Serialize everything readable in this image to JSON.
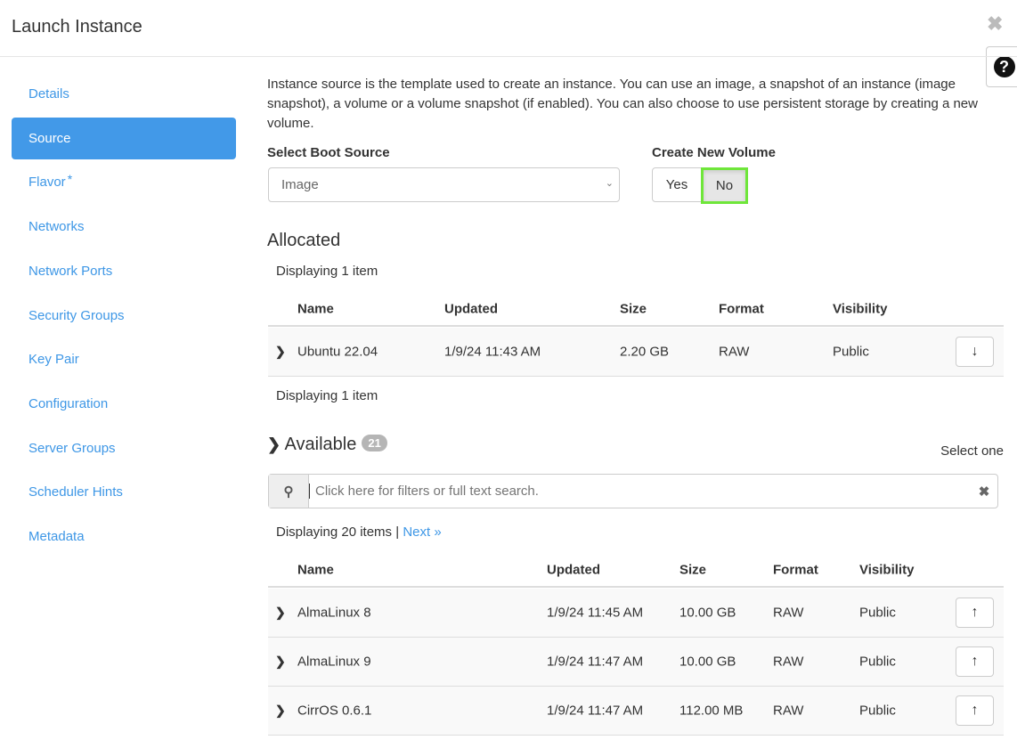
{
  "header": {
    "title": "Launch Instance",
    "close_icon": "close-icon",
    "help_icon": "question-circle-icon"
  },
  "sidebar": {
    "items": [
      {
        "label": "Details"
      },
      {
        "label": "Source",
        "active": true
      },
      {
        "label": "Flavor",
        "required": "*"
      },
      {
        "label": "Networks"
      },
      {
        "label": "Network Ports"
      },
      {
        "label": "Security Groups"
      },
      {
        "label": "Key Pair"
      },
      {
        "label": "Configuration"
      },
      {
        "label": "Server Groups"
      },
      {
        "label": "Scheduler Hints"
      },
      {
        "label": "Metadata"
      }
    ]
  },
  "main": {
    "description": "Instance source is the template used to create an instance. You can use an image, a snapshot of an instance (image snapshot), a volume or a volume snapshot (if enabled). You can also choose to use persistent storage by creating a new volume.",
    "boot_source": {
      "label": "Select Boot Source",
      "value": "Image"
    },
    "new_volume": {
      "label": "Create New Volume",
      "yes": "Yes",
      "no": "No",
      "selected": "No"
    },
    "allocated": {
      "title": "Allocated",
      "count_top": "Displaying 1 item",
      "count_bottom": "Displaying 1 item",
      "columns": [
        "Name",
        "Updated",
        "Size",
        "Format",
        "Visibility"
      ],
      "rows": [
        {
          "name": "Ubuntu 22.04",
          "updated": "1/9/24 11:43 AM",
          "size": "2.20 GB",
          "format": "RAW",
          "visibility": "Public"
        }
      ]
    },
    "available": {
      "title": "Available",
      "badge": "21",
      "select_hint": "Select one",
      "search_placeholder": "Click here for filters or full text search.",
      "count": "Displaying 20 items",
      "separator": "|",
      "next": "Next »",
      "columns": [
        "Name",
        "Updated",
        "Size",
        "Format",
        "Visibility"
      ],
      "rows": [
        {
          "name": "AlmaLinux 8",
          "updated": "1/9/24 11:45 AM",
          "size": "10.00 GB",
          "format": "RAW",
          "visibility": "Public"
        },
        {
          "name": "AlmaLinux 9",
          "updated": "1/9/24 11:47 AM",
          "size": "10.00 GB",
          "format": "RAW",
          "visibility": "Public"
        },
        {
          "name": "CirrOS 0.6.1",
          "updated": "1/9/24 11:47 AM",
          "size": "112.00 MB",
          "format": "RAW",
          "visibility": "Public"
        }
      ]
    }
  },
  "colors": {
    "accent": "#4299e8",
    "link": "#3e97e6",
    "focus": "#6fe63a"
  }
}
